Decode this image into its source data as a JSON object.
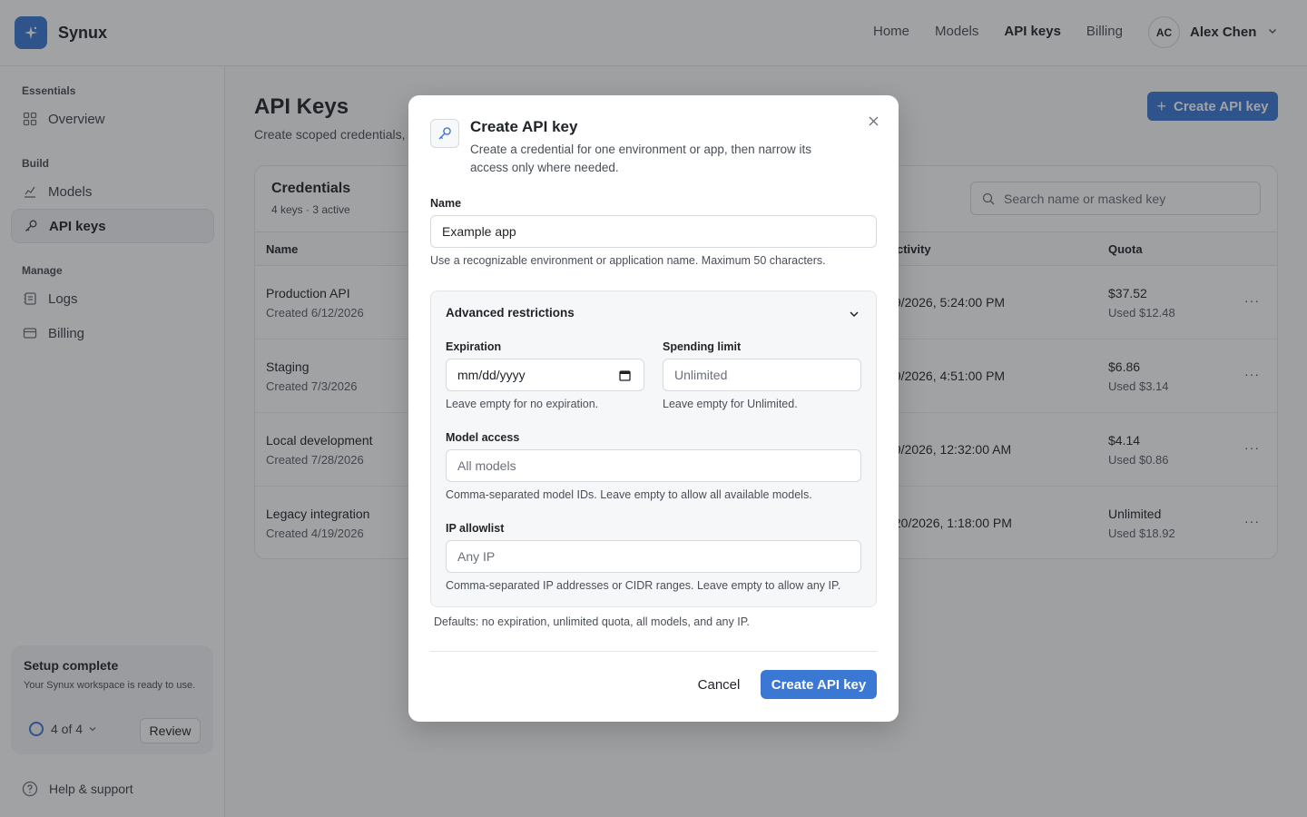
{
  "app": {
    "brand": "Synux"
  },
  "topnav": {
    "items": [
      "Home",
      "Models",
      "API keys",
      "Billing"
    ],
    "active": "API keys"
  },
  "user": {
    "initials": "AC",
    "name": "Alex Chen"
  },
  "sidebar": {
    "sections": [
      "Essentials",
      "Build",
      "Manage"
    ],
    "items": [
      {
        "label": "Overview",
        "icon": "grid-icon"
      },
      {
        "label": "Models",
        "icon": "chart-icon"
      },
      {
        "label": "API keys",
        "icon": "key-icon",
        "active": true
      },
      {
        "label": "Logs",
        "icon": "logs-icon"
      },
      {
        "label": "Billing",
        "icon": "card-icon"
      }
    ],
    "setup": {
      "title": "Setup complete",
      "desc": "Your Synux workspace is ready to use.",
      "progress": "4 of 4",
      "review": "Review"
    },
    "help": "Help & support"
  },
  "main": {
    "title": "API Keys",
    "subtitle": "Create scoped credentials, r",
    "create_button": "Create API key",
    "panel": {
      "title": "Credentials",
      "subtitle": "4 keys · 3 active",
      "search_placeholder": "Search name or masked key",
      "columns": [
        "Name",
        "ctivity",
        "Quota"
      ],
      "rows": [
        {
          "name": "Production API",
          "created": "Created 6/12/2026",
          "activity": "/9/2026, 5:24:00 PM",
          "quota": "$37.52",
          "used": "Used $12.48"
        },
        {
          "name": "Staging",
          "created": "Created 7/3/2026",
          "activity": "/9/2026, 4:51:00 PM",
          "quota": "$6.86",
          "used": "Used $3.14"
        },
        {
          "name": "Local development",
          "created": "Created 7/28/2026",
          "activity": "/9/2026, 12:32:00 AM",
          "quota": "$4.14",
          "used": "Used $0.86"
        },
        {
          "name": "Legacy integration",
          "created": "Created 4/19/2026",
          "activity": "/20/2026, 1:18:00 PM",
          "quota": "Unlimited",
          "used": "Used $18.92"
        }
      ],
      "more": "···"
    }
  },
  "modal": {
    "title": "Create API key",
    "desc": "Create a credential for one environment or app, then narrow its access only where needed.",
    "name_label": "Name",
    "name_value": "Example app",
    "name_hint": "Use a recognizable environment or application name. Maximum 50 characters.",
    "advanced": {
      "title": "Advanced restrictions",
      "expiration_label": "Expiration",
      "expiration_placeholder": "mm/dd/yyyy",
      "expiration_hint": "Leave empty for no expiration.",
      "spending_label": "Spending limit",
      "spending_placeholder": "Unlimited",
      "spending_hint": "Leave empty for Unlimited.",
      "models_label": "Model access",
      "models_placeholder": "All models",
      "models_hint": "Comma-separated model IDs. Leave empty to allow all available models.",
      "ip_label": "IP allowlist",
      "ip_placeholder": "Any IP",
      "ip_hint": "Comma-separated IP addresses or CIDR ranges. Leave empty to allow any IP."
    },
    "defaults": "Defaults: no expiration, unlimited quota, all models, and any IP.",
    "cancel": "Cancel",
    "submit": "Create API key"
  },
  "colors": {
    "accent": "#3b78d4",
    "overlay": "rgba(32,34,38,0.42)"
  }
}
